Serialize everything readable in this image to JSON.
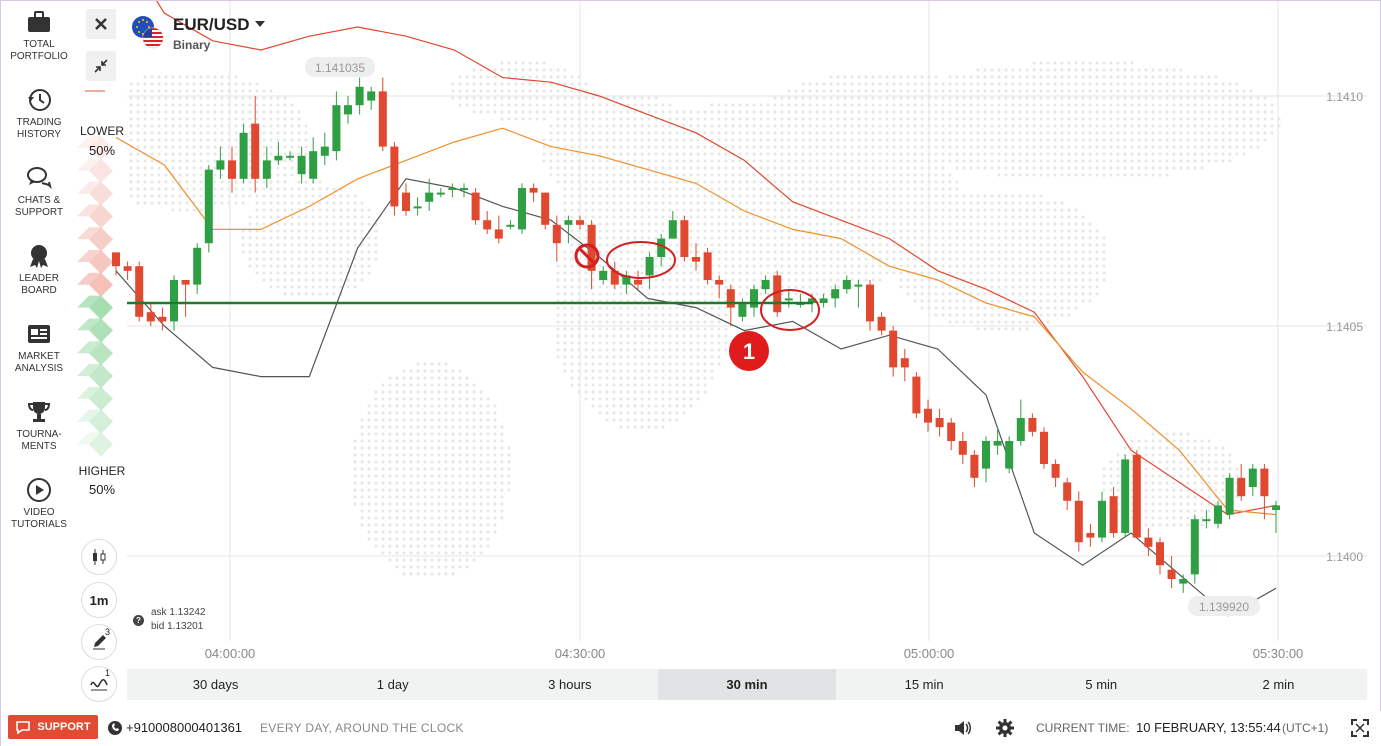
{
  "sidebar": {
    "items": [
      {
        "label_1": "TOTAL",
        "label_2": "PORTFOLIO",
        "icon": "briefcase-icon"
      },
      {
        "label_1": "TRADING",
        "label_2": "HISTORY",
        "icon": "history-icon"
      },
      {
        "label_1": "CHATS &",
        "label_2": "SUPPORT",
        "icon": "chat-icon"
      },
      {
        "label_1": "LEADER",
        "label_2": "BOARD",
        "icon": "medal-icon"
      },
      {
        "label_1": "MARKET",
        "label_2": "ANALYSIS",
        "icon": "news-icon"
      },
      {
        "label_1": "TOURNA-",
        "label_2": "MENTS",
        "icon": "trophy-icon"
      },
      {
        "label_1": "VIDEO",
        "label_2": "TUTORIALS",
        "icon": "play-icon"
      }
    ]
  },
  "header": {
    "asset_name": "EUR/USD",
    "asset_type": "Binary",
    "close_icon": "close-icon",
    "collapse_icon": "collapse-icon"
  },
  "trade": {
    "lower_label": "LOWER",
    "lower_pct": "50%",
    "higher_label": "HIGHER",
    "higher_pct": "50%"
  },
  "controls": {
    "chart_type_icon": "candles-icon",
    "timeframe": "1m",
    "drawing_count": "3",
    "indicator_count": "1"
  },
  "quote": {
    "ask": "ask 1.13242",
    "bid": "bid 1.13201",
    "help_icon": "?"
  },
  "ranges": [
    "30 days",
    "1 day",
    "3 hours",
    "30 min",
    "15 min",
    "5 min",
    "2 min"
  ],
  "active_range": "30 min",
  "footer": {
    "support_label": "SUPPORT",
    "phone": "+910008000401361",
    "phone_note": "EVERY DAY, AROUND THE CLOCK",
    "current_time_label": "CURRENT TIME:",
    "current_time": "10 FEBRUARY, 13:55:44",
    "timezone": "(UTC+1)"
  },
  "chart_data": {
    "type": "candlestick",
    "instrument": "EUR/USD",
    "x_ticks": [
      "04:00:00",
      "04:30:00",
      "05:00:00",
      "05:30:00"
    ],
    "y_ticks": [
      "1.1410",
      "1.1405",
      "1.1400"
    ],
    "ylim": [
      1.13985,
      1.14125
    ],
    "max_label": "1.141035",
    "min_label": "1.139920",
    "annotation_number": "1",
    "colors": {
      "up": "#2ea043",
      "down": "#e0482f",
      "upper_band": "#e0482f",
      "middle_band": "#f0902a",
      "lower_band": "#555555",
      "strike": "#1f7a2e"
    },
    "strike_level": 1.14055,
    "candles": [
      [
        1.14066,
        1.14066,
        1.14061,
        1.14063
      ],
      [
        1.14063,
        1.14064,
        1.1406,
        1.14062
      ],
      [
        1.14063,
        1.14064,
        1.14051,
        1.14052
      ],
      [
        1.14053,
        1.14055,
        1.1405,
        1.14051
      ],
      [
        1.14052,
        1.14054,
        1.14049,
        1.14051
      ],
      [
        1.14051,
        1.14061,
        1.14049,
        1.1406
      ],
      [
        1.1406,
        1.1406,
        1.14052,
        1.14059
      ],
      [
        1.14059,
        1.14068,
        1.14057,
        1.14067
      ],
      [
        1.14068,
        1.14085,
        1.14066,
        1.14084
      ],
      [
        1.14084,
        1.14089,
        1.14082,
        1.14086
      ],
      [
        1.14086,
        1.14089,
        1.14079,
        1.14082
      ],
      [
        1.14082,
        1.14094,
        1.14081,
        1.14092
      ],
      [
        1.14094,
        1.141,
        1.14079,
        1.14082
      ],
      [
        1.14082,
        1.14089,
        1.1408,
        1.14086
      ],
      [
        1.14086,
        1.1409,
        1.14085,
        1.14087
      ],
      [
        1.14087,
        1.14088,
        1.14086,
        1.14087
      ],
      [
        1.14083,
        1.14089,
        1.14081,
        1.14087
      ],
      [
        1.14082,
        1.14091,
        1.14081,
        1.14088
      ],
      [
        1.14087,
        1.14092,
        1.14085,
        1.14089
      ],
      [
        1.14088,
        1.14101,
        1.14086,
        1.14098
      ],
      [
        1.14096,
        1.141,
        1.14094,
        1.14098
      ],
      [
        1.14098,
        1.14104,
        1.14096,
        1.14102
      ],
      [
        1.14099,
        1.14102,
        1.14097,
        1.14101
      ],
      [
        1.14101,
        1.14104,
        1.14088,
        1.14089
      ],
      [
        1.14089,
        1.1409,
        1.14074,
        1.14076
      ],
      [
        1.14079,
        1.14081,
        1.14074,
        1.14075
      ],
      [
        1.14076,
        1.14078,
        1.14074,
        1.14076
      ],
      [
        1.14077,
        1.14082,
        1.14075,
        1.14079
      ],
      [
        1.14079,
        1.1408,
        1.14078,
        1.14079
      ],
      [
        1.1408,
        1.14081,
        1.14078,
        1.1408
      ],
      [
        1.1408,
        1.14081,
        1.14078,
        1.1408
      ],
      [
        1.14079,
        1.1408,
        1.14072,
        1.14073
      ],
      [
        1.14073,
        1.14075,
        1.1407,
        1.14071
      ],
      [
        1.14071,
        1.14074,
        1.14068,
        1.14069
      ],
      [
        1.14072,
        1.14073,
        1.14071,
        1.14072
      ],
      [
        1.14071,
        1.14081,
        1.1407,
        1.1408
      ],
      [
        1.1408,
        1.14081,
        1.14077,
        1.14079
      ],
      [
        1.14079,
        1.14079,
        1.14071,
        1.14072
      ],
      [
        1.14072,
        1.14074,
        1.14064,
        1.14068
      ],
      [
        1.14072,
        1.14074,
        1.14068,
        1.14073
      ],
      [
        1.14073,
        1.14074,
        1.14071,
        1.14072
      ],
      [
        1.14072,
        1.14073,
        1.14058,
        1.14062
      ],
      [
        1.1406,
        1.14063,
        1.14059,
        1.14062
      ],
      [
        1.14062,
        1.14064,
        1.14058,
        1.14059
      ],
      [
        1.14059,
        1.14062,
        1.14057,
        1.14061
      ],
      [
        1.1406,
        1.14062,
        1.14058,
        1.14059
      ],
      [
        1.14061,
        1.14066,
        1.14058,
        1.14065
      ],
      [
        1.14065,
        1.1407,
        1.14063,
        1.14069
      ],
      [
        1.14069,
        1.14075,
        1.14069,
        1.14073
      ],
      [
        1.14073,
        1.14074,
        1.14064,
        1.14065
      ],
      [
        1.14065,
        1.14068,
        1.14062,
        1.14064
      ],
      [
        1.14066,
        1.14067,
        1.14059,
        1.1406
      ],
      [
        1.1406,
        1.14061,
        1.14056,
        1.14059
      ],
      [
        1.14058,
        1.14059,
        1.1405,
        1.14054
      ],
      [
        1.14052,
        1.14056,
        1.14051,
        1.14055
      ],
      [
        1.14054,
        1.14059,
        1.14052,
        1.14058
      ],
      [
        1.14058,
        1.14061,
        1.14057,
        1.1406
      ],
      [
        1.14061,
        1.14062,
        1.14052,
        1.14053
      ],
      [
        1.14056,
        1.14058,
        1.14054,
        1.14056
      ],
      [
        1.14055,
        1.14057,
        1.14054,
        1.14055
      ],
      [
        1.14055,
        1.14057,
        1.14053,
        1.14056
      ],
      [
        1.14055,
        1.14057,
        1.14054,
        1.14056
      ],
      [
        1.14056,
        1.14059,
        1.14054,
        1.14058
      ],
      [
        1.14058,
        1.14061,
        1.14057,
        1.1406
      ],
      [
        1.14059,
        1.1406,
        1.14054,
        1.14059
      ],
      [
        1.14059,
        1.1406,
        1.14049,
        1.14051
      ],
      [
        1.14052,
        1.14053,
        1.14048,
        1.14049
      ],
      [
        1.14049,
        1.1405,
        1.14039,
        1.14041
      ],
      [
        1.14043,
        1.14045,
        1.14038,
        1.14041
      ],
      [
        1.14039,
        1.1404,
        1.1403,
        1.14031
      ],
      [
        1.14032,
        1.14034,
        1.14027,
        1.14029
      ],
      [
        1.1403,
        1.14032,
        1.14026,
        1.14028
      ],
      [
        1.14029,
        1.1403,
        1.14023,
        1.14025
      ],
      [
        1.14025,
        1.14027,
        1.1402,
        1.14022
      ],
      [
        1.14022,
        1.14023,
        1.14015,
        1.14017
      ],
      [
        1.14019,
        1.14026,
        1.14016,
        1.14025
      ],
      [
        1.14024,
        1.14028,
        1.14022,
        1.14025
      ],
      [
        1.14019,
        1.14026,
        1.14018,
        1.14025
      ],
      [
        1.14025,
        1.14034,
        1.14024,
        1.1403
      ],
      [
        1.1403,
        1.14031,
        1.14026,
        1.14027
      ],
      [
        1.14027,
        1.14028,
        1.14019,
        1.1402
      ],
      [
        1.1402,
        1.14021,
        1.14015,
        1.14017
      ],
      [
        1.14016,
        1.14017,
        1.1401,
        1.14012
      ],
      [
        1.14012,
        1.14014,
        1.14001,
        1.14003
      ],
      [
        1.14005,
        1.14007,
        1.14002,
        1.14004
      ],
      [
        1.14004,
        1.14014,
        1.14003,
        1.14012
      ],
      [
        1.14013,
        1.14015,
        1.14004,
        1.14005
      ],
      [
        1.14005,
        1.14022,
        1.14004,
        1.14021
      ],
      [
        1.14022,
        1.14023,
        1.14004,
        1.14004
      ],
      [
        1.14004,
        1.14006,
        1.14,
        1.14002
      ],
      [
        1.14003,
        1.14004,
        1.13996,
        1.13998
      ],
      [
        1.13997,
        1.14,
        1.13993,
        1.13995
      ],
      [
        1.13994,
        1.13996,
        1.13992,
        1.13995
      ],
      [
        1.13996,
        1.14009,
        1.13994,
        1.14008
      ],
      [
        1.14008,
        1.1401,
        1.14006,
        1.14008
      ],
      [
        1.14007,
        1.14012,
        1.14006,
        1.14011
      ],
      [
        1.14009,
        1.14018,
        1.14008,
        1.14017
      ],
      [
        1.14017,
        1.1402,
        1.14012,
        1.14013
      ],
      [
        1.14015,
        1.1402,
        1.14013,
        1.14019
      ],
      [
        1.14019,
        1.1402,
        1.14008,
        1.14013
      ],
      [
        1.1401,
        1.14012,
        1.14005,
        1.14011
      ]
    ],
    "upper_band": [
      1.14135,
      1.14118,
      1.14112,
      1.1411,
      1.14113,
      1.14115,
      1.14113,
      1.1411,
      1.14104,
      1.14103,
      1.141,
      1.14096,
      1.14092,
      1.14086,
      1.14077,
      1.14073,
      1.14069,
      1.14062,
      1.14058,
      1.14053,
      1.14039,
      1.14023,
      1.14016,
      1.14009,
      1.14011
    ],
    "middle_band": [
      1.14091,
      1.14085,
      1.14071,
      1.14071,
      1.14076,
      1.14082,
      1.14086,
      1.1409,
      1.14093,
      1.14089,
      1.14087,
      1.14084,
      1.14081,
      1.14075,
      1.14071,
      1.14069,
      1.14063,
      1.1406,
      1.14055,
      1.14052,
      1.1404,
      1.14032,
      1.14023,
      1.1401,
      1.14009
    ],
    "lower_band": [
      1.14062,
      1.1405,
      1.14041,
      1.14039,
      1.14039,
      1.14067,
      1.14082,
      1.1408,
      1.14076,
      1.14073,
      1.14065,
      1.14056,
      1.14054,
      1.14049,
      1.14051,
      1.14045,
      1.14048,
      1.14045,
      1.14035,
      1.14005,
      1.13998,
      1.14005,
      1.13996,
      1.13987,
      1.13993
    ]
  }
}
